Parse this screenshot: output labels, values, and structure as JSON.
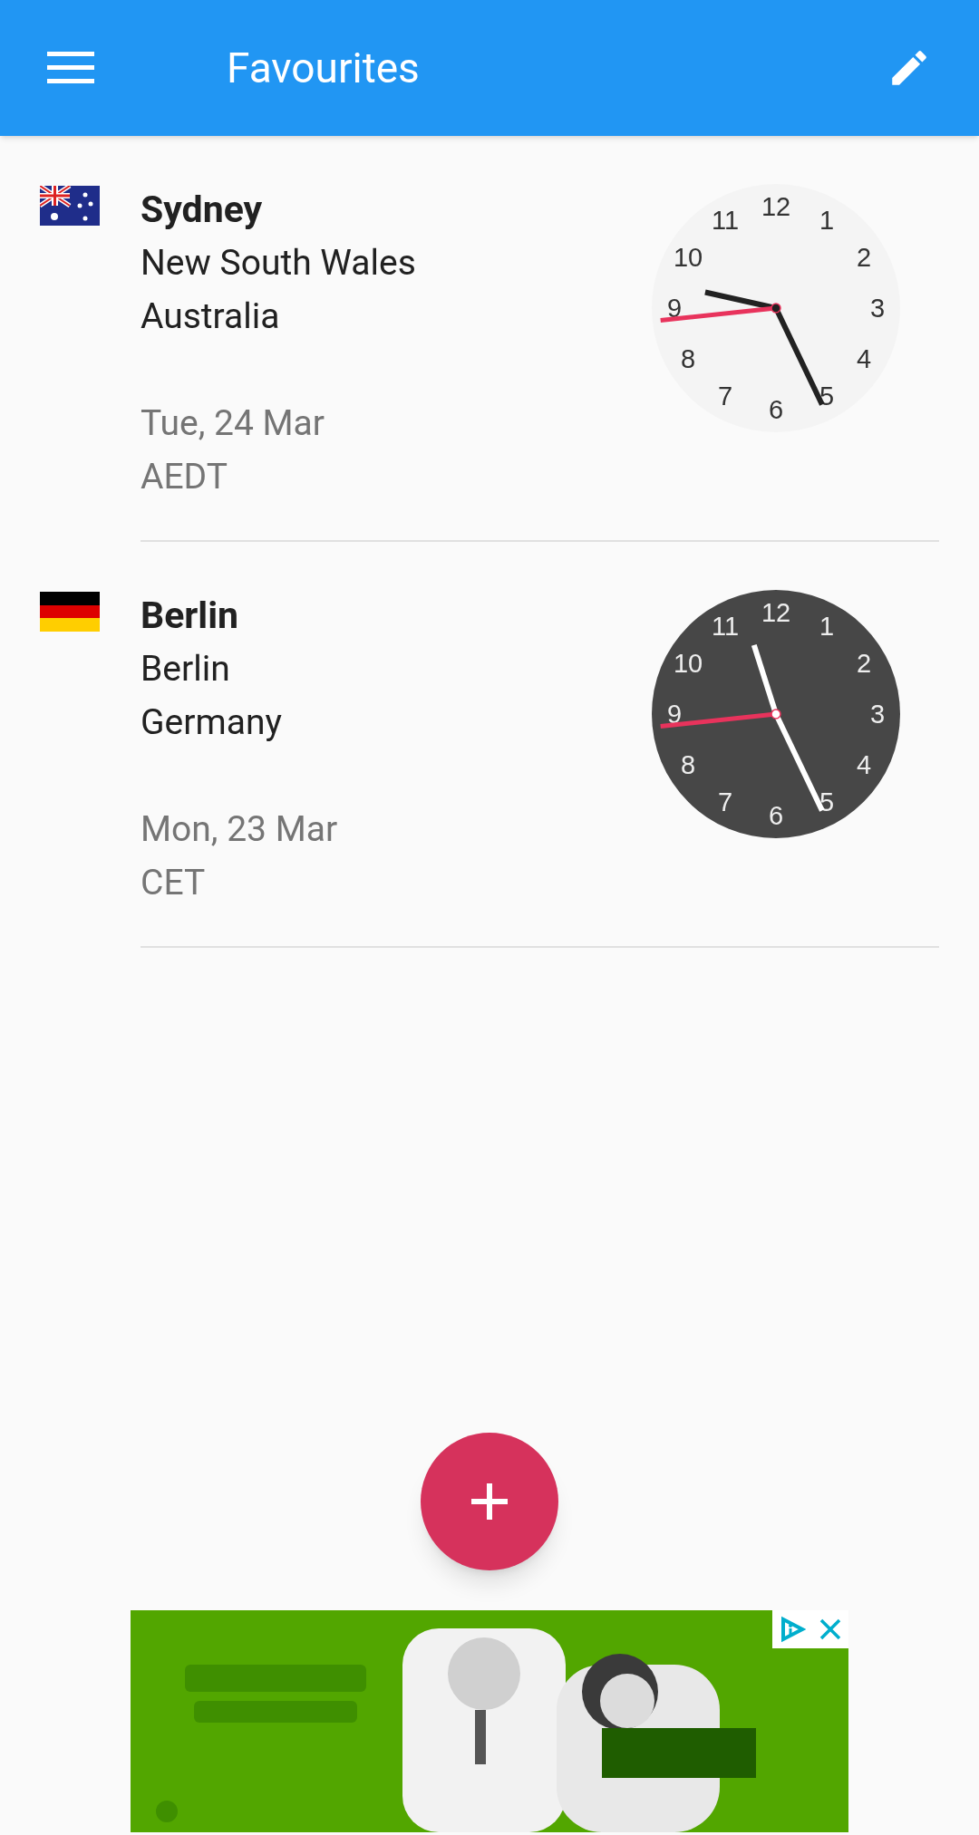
{
  "app_bar": {
    "title": "Favourites"
  },
  "favourites": [
    {
      "flag": {
        "kind": "australia"
      },
      "city": "Sydney",
      "region": "New South Wales",
      "country": "Australia",
      "date": "Tue, 24 Mar",
      "zone": "AEDT",
      "clock": {
        "kind": "day",
        "numerals": [
          "12",
          "1",
          "2",
          "3",
          "4",
          "5",
          "6",
          "7",
          "8",
          "9",
          "10",
          "11"
        ]
      }
    },
    {
      "flag": {
        "kind": "germany"
      },
      "city": "Berlin",
      "region": "Berlin",
      "country": "Germany",
      "date": "Mon, 23 Mar",
      "zone": "CET",
      "clock": {
        "kind": "night",
        "numerals": [
          "12",
          "1",
          "2",
          "3",
          "4",
          "5",
          "6",
          "7",
          "8",
          "9",
          "10",
          "11"
        ]
      }
    }
  ]
}
